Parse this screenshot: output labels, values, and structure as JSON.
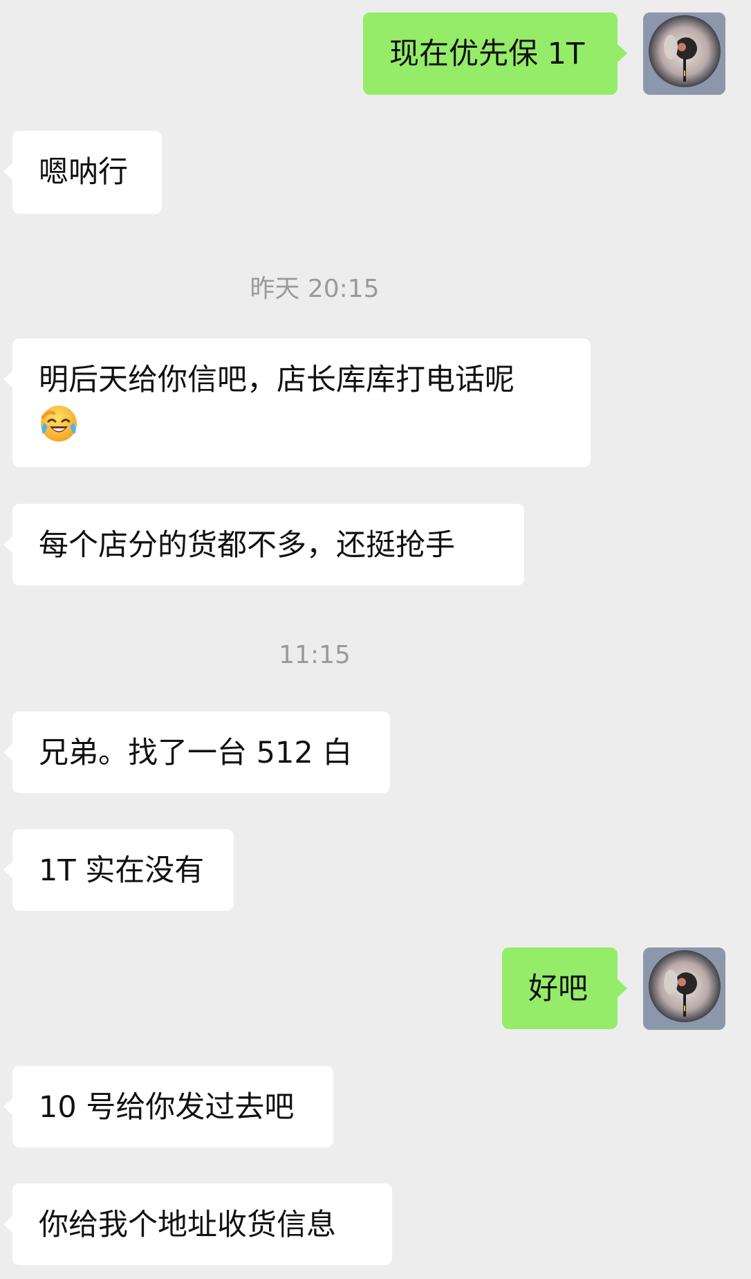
{
  "chat": {
    "messages": [
      {
        "side": "out",
        "text": "现在优先保 1T"
      },
      {
        "side": "in",
        "text": "嗯呐行"
      },
      {
        "side": "timestamp",
        "text": "昨天 20:15"
      },
      {
        "side": "in",
        "text": "明后天给你信吧，店长库库打电话呢",
        "emoji": "face-with-tears-of-joy"
      },
      {
        "side": "in",
        "text": "每个店分的货都不多，还挺抢手"
      },
      {
        "side": "timestamp",
        "text": "11:15"
      },
      {
        "side": "in",
        "text": "兄弟。找了一台 512 白"
      },
      {
        "side": "in",
        "text": "1T 实在没有"
      },
      {
        "side": "out",
        "text": "好吧"
      },
      {
        "side": "in",
        "text": "10 号给你发过去吧"
      },
      {
        "side": "in",
        "text": "你给我个地址收货信息"
      }
    ]
  },
  "colors": {
    "background": "#ededed",
    "incoming_bubble": "#ffffff",
    "outgoing_bubble": "#95ec69",
    "timestamp_text": "#9a9a9a"
  },
  "icons": {
    "avatar": "user-avatar-photo",
    "emoji": "face-with-tears-of-joy"
  }
}
